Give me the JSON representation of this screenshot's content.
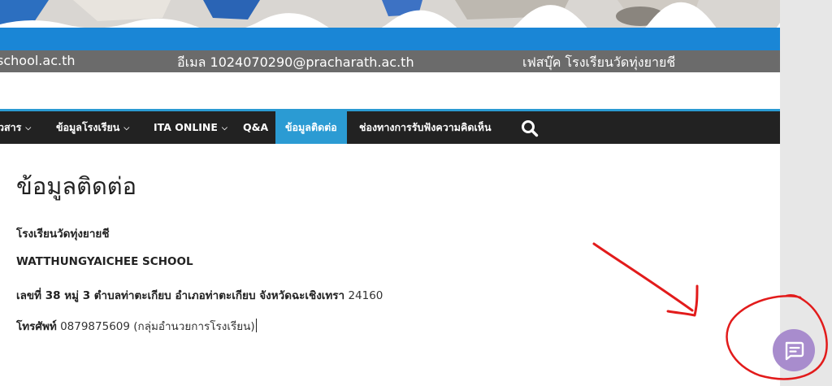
{
  "banner": {
    "website_fragment": "school.ac.th",
    "email": "อีเมล 1024070290@pracharath.ac.th",
    "facebook": "เฟสบุ๊ค โรงเรียนวัดทุ่งยายชี"
  },
  "nav": {
    "items": [
      {
        "label": "วสาร",
        "has_dropdown": true
      },
      {
        "label": "ข้อมูลโรงเรียน",
        "has_dropdown": true
      },
      {
        "label": "ITA ONLINE",
        "has_dropdown": true
      },
      {
        "label": "Q&A",
        "has_dropdown": false
      },
      {
        "label": "ข้อมูลติดต่อ",
        "has_dropdown": false,
        "active": true
      },
      {
        "label": "ช่องทางการรับฟังความคิดเห็น",
        "has_dropdown": false
      }
    ],
    "search_icon": "search-icon",
    "active_color": "#2b9bd3"
  },
  "content": {
    "title": "ข้อมูลติดต่อ",
    "school_name_th": "โรงเรียนวัดทุ่งยายชี",
    "school_name_en": "WATTHUNGYAICHEE SCHOOL",
    "address_label": "เลขที่ 38 หมู่ 3 ตำบลท่าตะเกียบ อำเภอท่าตะเกียบ จังหวัดฉะเชิงเทรา",
    "address_postcode": "24160",
    "phone_label": "โทรศัพท์",
    "phone_value": "0879875609 (กลุ่มอำนวยการโรงเรียน)"
  },
  "chat_widget": {
    "icon": "chat-bubble-icon",
    "color": "#a88ccd",
    "annotation_color": "#e21b1b"
  }
}
